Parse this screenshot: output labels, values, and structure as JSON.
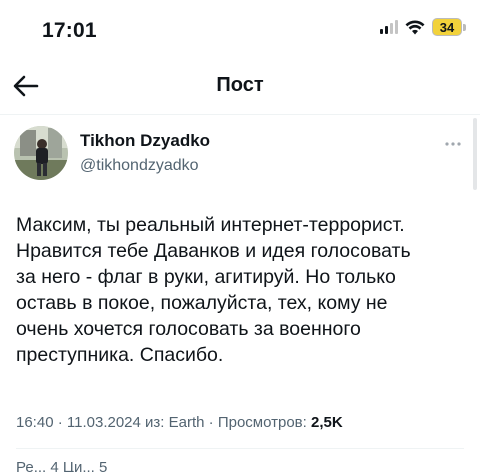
{
  "status_bar": {
    "time": "17:01",
    "battery_level": "34",
    "battery_color": "#f2d23b",
    "icons": [
      "signal-icon",
      "wifi-icon",
      "battery-icon"
    ]
  },
  "nav": {
    "title": "Пост",
    "back_icon": "arrow-left-icon"
  },
  "post": {
    "author": {
      "name": "Tikhon Dzyadko",
      "handle": "@tikhondzyadko"
    },
    "more_icon": "more-horizontal-icon",
    "text": "Максим, ты реальный интернет-террорист.\nНравится тебе Даванков и идея голосовать\nза него - флаг в руки, агитируй. Но только\nоставь в покое, пожалуйста, тех, кому не\nочень хочется голосовать за военного\nпреступника. Спасибо.",
    "meta": {
      "time": "16:40",
      "separator": " · ",
      "date": "11.03.2024",
      "source_prefix": " из: ",
      "source": "Earth",
      "views_label": "Просмотров: ",
      "views_count": "2,5K"
    },
    "stats_partial": "Ре...    4   Ци...     5"
  },
  "colors": {
    "text_primary": "#0f1419",
    "text_secondary": "#536471",
    "divider": "#eff3f4"
  }
}
